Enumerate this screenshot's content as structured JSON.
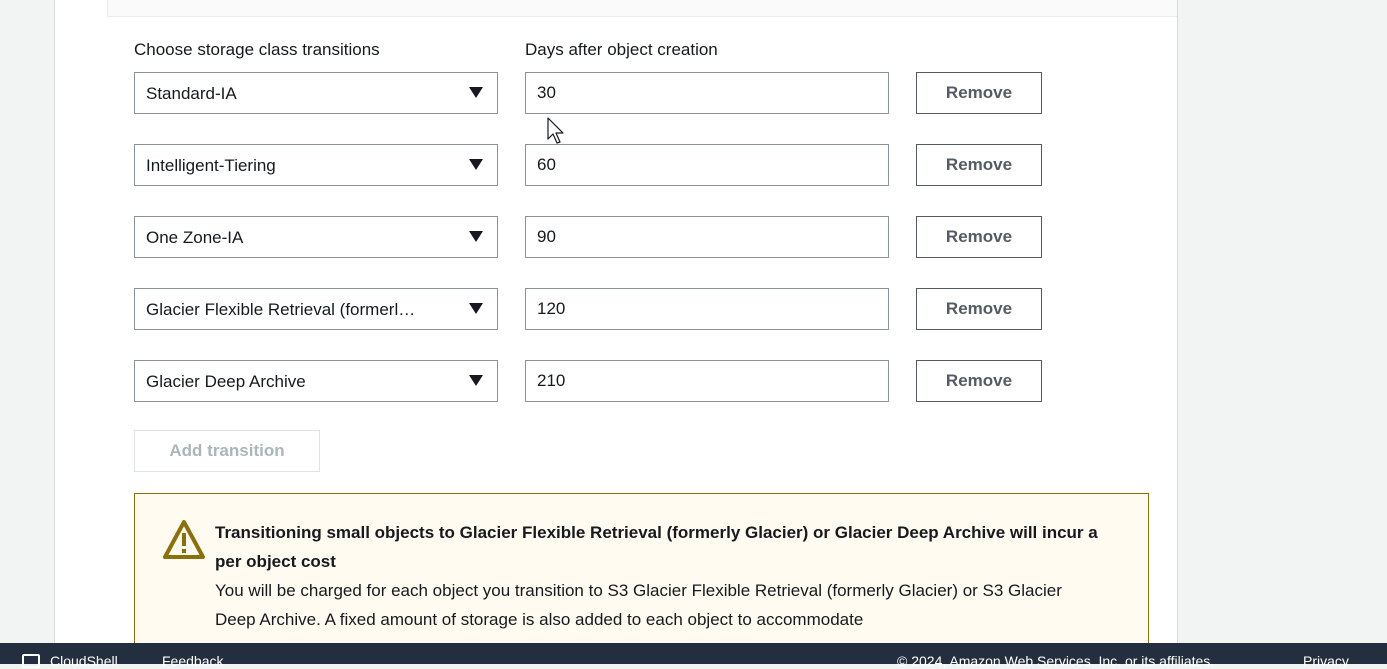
{
  "labels": {
    "storage_class": "Choose storage class transitions",
    "days": "Days after object creation"
  },
  "transitions": [
    {
      "storage_class": "Standard-IA",
      "days": "30",
      "remove": "Remove"
    },
    {
      "storage_class": "Intelligent-Tiering",
      "days": "60",
      "remove": "Remove"
    },
    {
      "storage_class": "One Zone-IA",
      "days": "90",
      "remove": "Remove"
    },
    {
      "storage_class": "Glacier Flexible Retrieval (formerl…",
      "days": "120",
      "remove": "Remove"
    },
    {
      "storage_class": "Glacier Deep Archive",
      "days": "210",
      "remove": "Remove"
    }
  ],
  "add_transition": "Add transition",
  "alert": {
    "title": "Transitioning small objects to Glacier Flexible Retrieval (formerly Glacier) or Glacier Deep Archive will incur a per object cost",
    "body": "You will be charged for each object you transition to S3 Glacier Flexible Retrieval (formerly Glacier) or S3 Glacier Deep Archive. A fixed amount of storage is also added to each object to accommodate",
    "icon": "warning-icon",
    "color": "#8b6f08"
  },
  "footer": {
    "cloudshell": "CloudShell",
    "feedback": "Feedback",
    "copyright": "© 2024, Amazon Web Services, Inc. or its affiliates.",
    "privacy": "Privacy"
  }
}
